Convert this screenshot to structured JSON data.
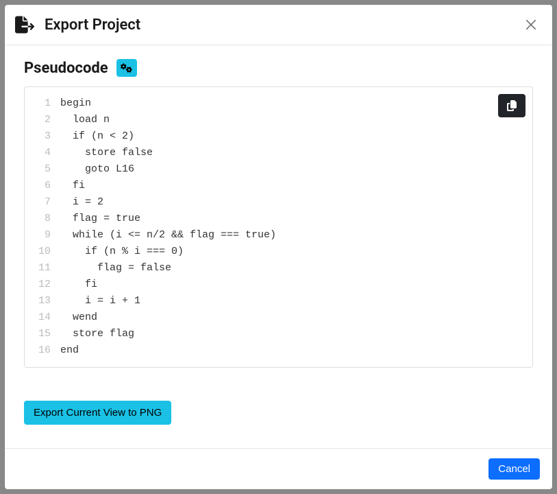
{
  "modal": {
    "title": "Export Project",
    "close_label": "Close"
  },
  "section": {
    "title": "Pseudocode"
  },
  "code": {
    "lines": [
      "begin",
      "  load n",
      "  if (n < 2)",
      "    store false",
      "    goto L16",
      "  fi",
      "  i = 2",
      "  flag = true",
      "  while (i <= n/2 && flag === true)",
      "    if (n % i === 0)",
      "      flag = false",
      "    fi",
      "    i = i + 1",
      "  wend",
      "  store flag",
      "end"
    ]
  },
  "buttons": {
    "export_png": "Export Current View to PNG",
    "cancel": "Cancel",
    "copy": "Copy"
  }
}
